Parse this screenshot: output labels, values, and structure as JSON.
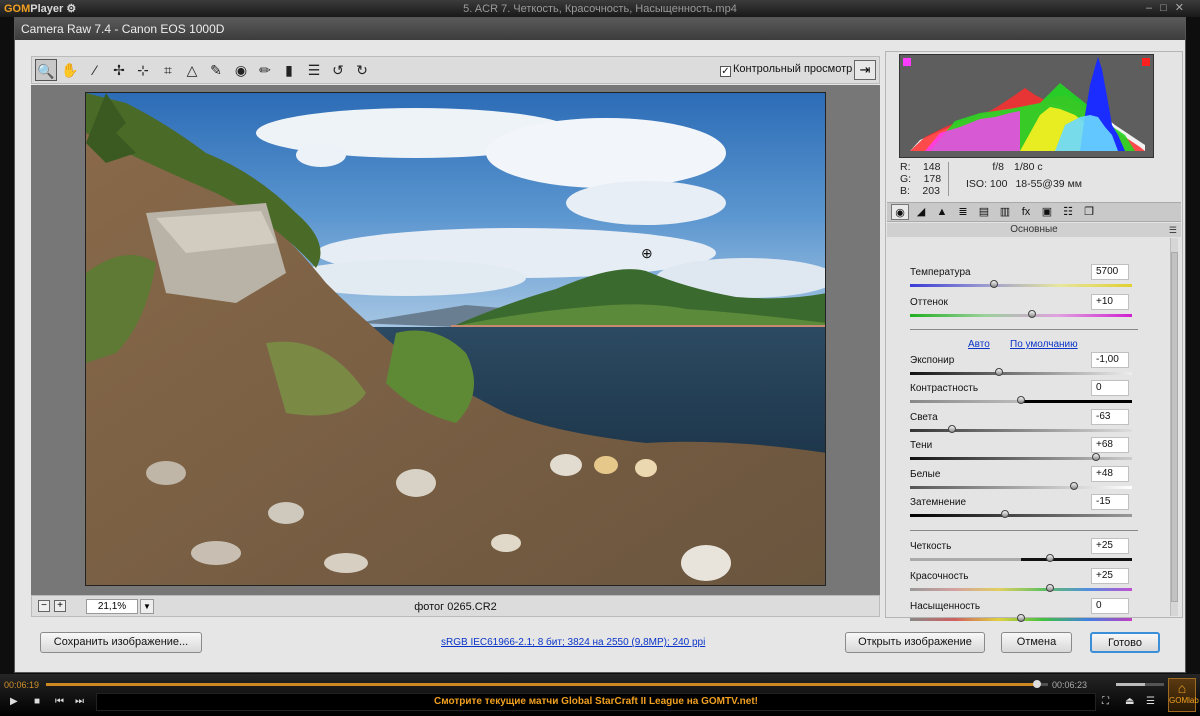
{
  "player": {
    "logo_gom": "GOM",
    "logo_player": "Player",
    "settings_icon": "gear-icon",
    "title": "5. ACR 7. Четкость, Красочность, Насыщенность.mp4",
    "time_elapsed": "00:06:19",
    "time_total": "00:06:23",
    "progress": 0.989,
    "volume": 0.6,
    "marquee": "Смотрите текущие матчи Global StarCraft II League на GOMTV.net!",
    "gomlab": "GOMlab"
  },
  "acr": {
    "title": "Camera Raw 7.4  -  Canon EOS 1000D",
    "tools": [
      "zoom-icon",
      "hand-icon",
      "eyedropper-icon",
      "color-sampler-icon",
      "target-adjust-icon",
      "crop-icon",
      "straighten-icon",
      "spot-removal-icon",
      "red-eye-icon",
      "adjustment-brush-icon",
      "gradient-icon",
      "list-icon",
      "rotate-ccw-icon",
      "rotate-cw-icon"
    ],
    "preview_label": "Контрольный просмотр",
    "zoom_value": "21,1%",
    "filename": "фотог 0265.CR2",
    "rgb": {
      "r_label": "R:",
      "r": "148",
      "g_label": "G:",
      "g": "178",
      "b_label": "B:",
      "b": "203"
    },
    "exif": {
      "aperture": "f/8",
      "shutter": "1/80 с",
      "iso": "ISO: 100",
      "lens": "18-55@39 мм"
    },
    "panel_title": "Основные",
    "link_auto": "Авто",
    "link_default": "По умолчанию",
    "sliders": {
      "temperature": {
        "label": "Температура",
        "value": "5700",
        "position": 0.38
      },
      "tint": {
        "label": "Оттенок",
        "value": "+10",
        "position": 0.55
      },
      "exposure": {
        "label": "Экспонир",
        "value": "-1,00",
        "position": 0.4
      },
      "contrast": {
        "label": "Контрастность",
        "value": "0",
        "position": 0.5
      },
      "highlights": {
        "label": "Света",
        "value": "-63",
        "position": 0.19
      },
      "shadows": {
        "label": "Тени",
        "value": "+68",
        "position": 0.84
      },
      "whites": {
        "label": "Белые",
        "value": "+48",
        "position": 0.74
      },
      "blacks": {
        "label": "Затемнение",
        "value": "-15",
        "position": 0.43
      },
      "clarity": {
        "label": "Четкость",
        "value": "+25",
        "position": 0.63
      },
      "vibrance": {
        "label": "Красочность",
        "value": "+25",
        "position": 0.63
      },
      "saturation": {
        "label": "Насыщенность",
        "value": "0",
        "position": 0.5
      }
    },
    "buttons": {
      "save": "Сохранить изображение...",
      "open": "Открыть изображение",
      "cancel": "Отмена",
      "done": "Готово"
    },
    "workflow_info": "sRGB IEC61966-2.1; 8 бит; 3824 на 2550 (9,8MP); 240 ppi"
  }
}
